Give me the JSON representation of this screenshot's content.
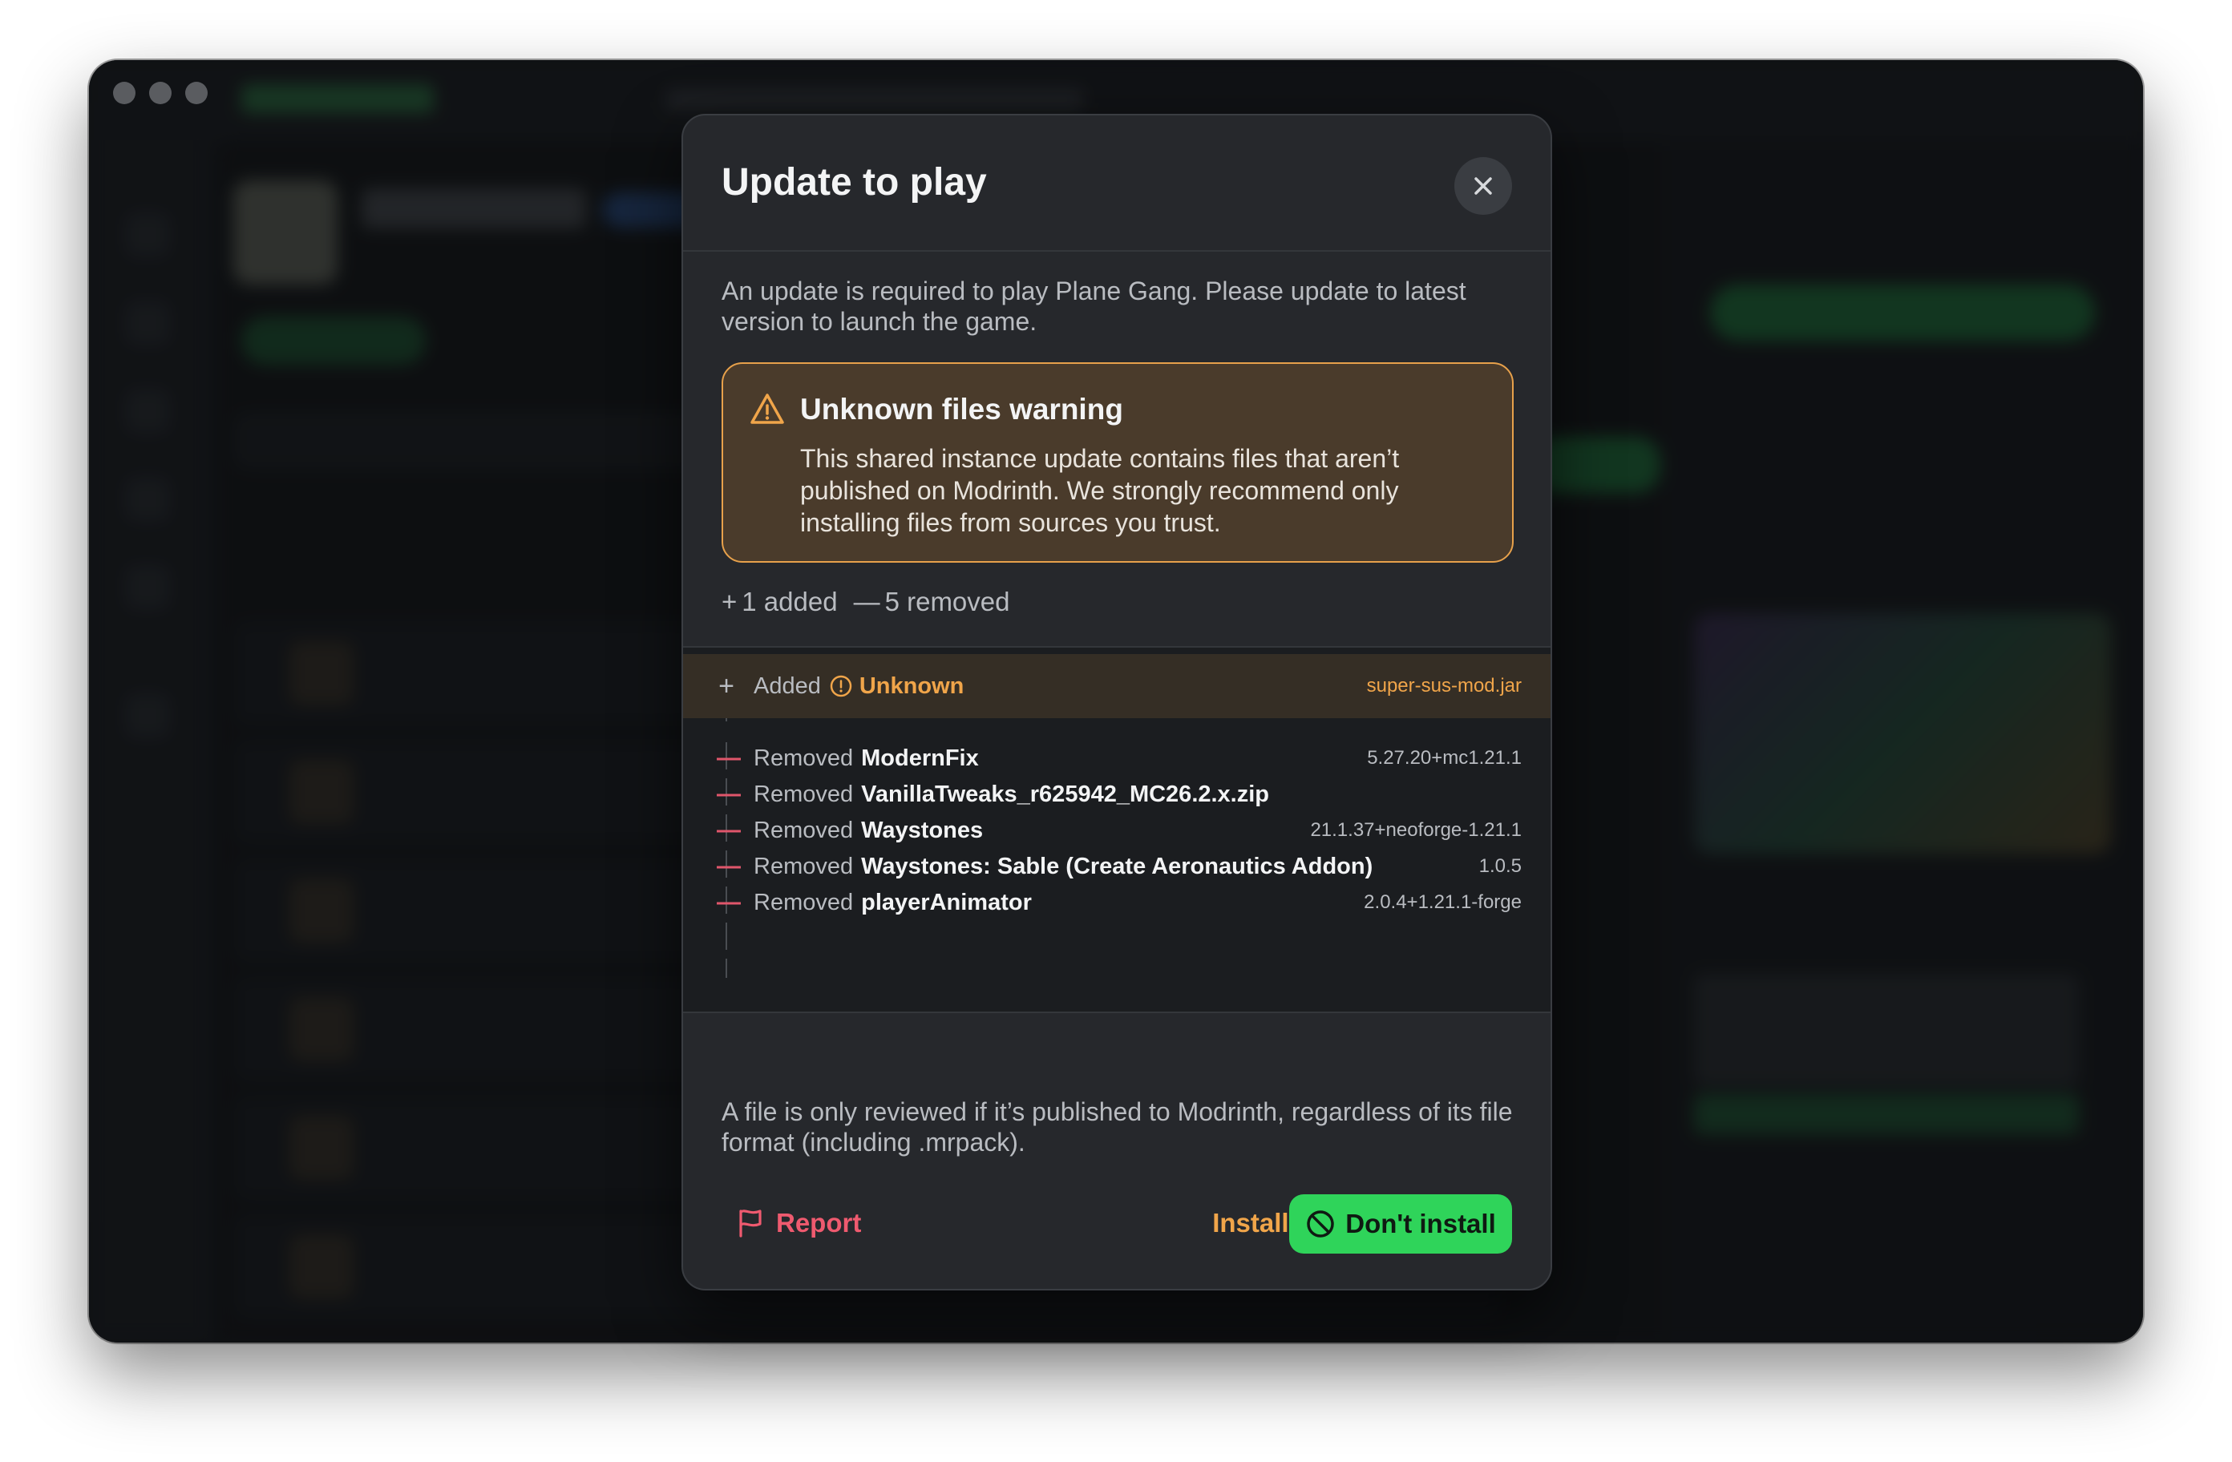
{
  "modal": {
    "title": "Update to play",
    "close_icon": "close-icon",
    "description": "An update is required to play Plane Gang. Please update to latest version to launch the game.",
    "warning": {
      "icon": "warning-triangle-icon",
      "title": "Unknown files warning",
      "body": "This shared instance update contains files that aren’t published on Modrinth. We strongly recommend only installing files from sources you trust."
    },
    "counts": {
      "added_symbol": "+",
      "added_label": "1 added",
      "removed_symbol": "—",
      "removed_label": "5 removed"
    },
    "changes": [
      {
        "kind": "added",
        "action": "Added",
        "name": "Unknown",
        "version": "super-sus-mod.jar"
      },
      {
        "kind": "removed",
        "action": "Removed",
        "name": "ModernFix",
        "version": "5.27.20+mc1.21.1"
      },
      {
        "kind": "removed",
        "action": "Removed",
        "name": "VanillaTweaks_r625942_MC26.2.x.zip",
        "version": ""
      },
      {
        "kind": "removed",
        "action": "Removed",
        "name": "Waystones",
        "version": "21.1.37+neoforge-1.21.1"
      },
      {
        "kind": "removed",
        "action": "Removed",
        "name": "Waystones: Sable (Create Aeronautics Addon)",
        "version": "1.0.5"
      },
      {
        "kind": "removed",
        "action": "Removed",
        "name": "playerAnimator",
        "version": "2.0.4+1.21.1-forge"
      }
    ],
    "footnote": "A file is only reviewed if it’s published to Modrinth, regardless of its file format (including .mrpack).",
    "buttons": {
      "report": "Report",
      "install_anyway": "Install anyway",
      "dont_install": "Don't install"
    }
  },
  "colors": {
    "accent_green": "#2fd45a",
    "warning_orange": "#f0a54a",
    "danger_red": "#ef5a6f"
  }
}
